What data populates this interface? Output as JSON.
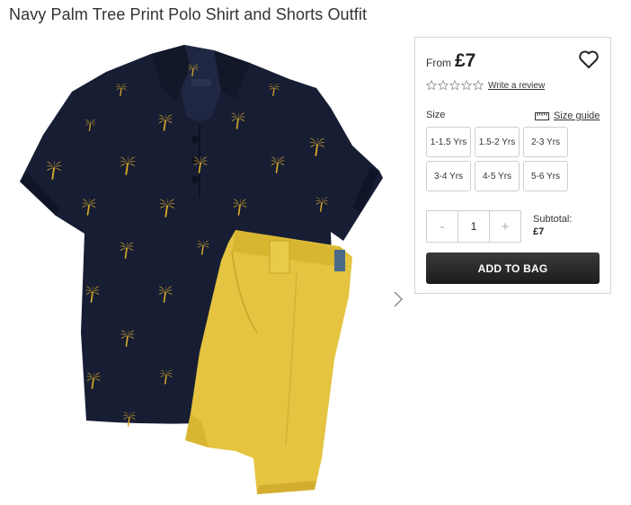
{
  "product": {
    "title": "Navy Palm Tree Print Polo Shirt and Shorts Outfit",
    "image_alt": "Navy palm tree print polo shirt with yellow shorts",
    "shirt_color": "#171d33",
    "print_color": "#d9a929",
    "shorts_color": "#e4c440"
  },
  "price": {
    "from_label": "From",
    "value": "£7"
  },
  "wishlist_icon": "heart-outline-icon",
  "rating": {
    "stars": 0,
    "max": 5,
    "review_link": "Write a review"
  },
  "size": {
    "label": "Size",
    "guide_label": "Size guide",
    "guide_icon": "ruler-icon",
    "options": [
      "1-1.5 Yrs",
      "1.5-2 Yrs",
      "2-3 Yrs",
      "3-4 Yrs",
      "4-5 Yrs",
      "5-6 Yrs"
    ]
  },
  "quantity": {
    "minus": "-",
    "value": "1",
    "plus": "+"
  },
  "subtotal": {
    "label": "Subtotal:",
    "value": "£7"
  },
  "cta": {
    "add_to_bag": "ADD TO BAG",
    "accent": "#222222"
  },
  "gallery": {
    "next_icon": "chevron-right-icon"
  }
}
